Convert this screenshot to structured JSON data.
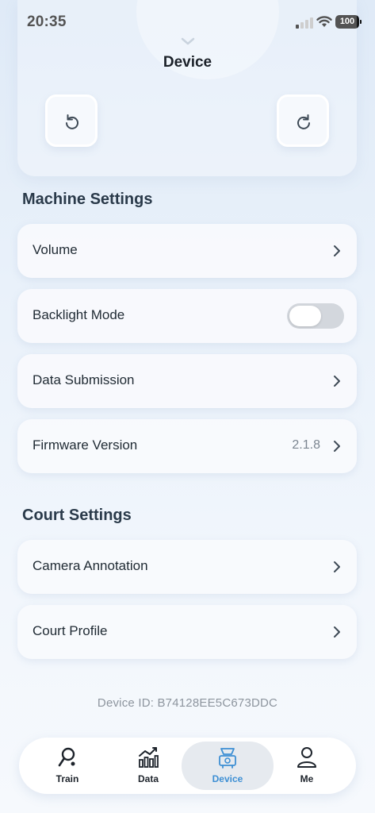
{
  "status_bar": {
    "time": "20:35",
    "battery": "100"
  },
  "header": {
    "title": "Device"
  },
  "machine_settings": {
    "title": "Machine Settings",
    "items": [
      {
        "label": "Volume"
      },
      {
        "label": "Backlight Mode",
        "toggle_on": false
      },
      {
        "label": "Data Submission"
      },
      {
        "label": "Firmware Version",
        "value": "2.1.8"
      }
    ]
  },
  "court_settings": {
    "title": "Court Settings",
    "items": [
      {
        "label": "Camera Annotation"
      },
      {
        "label": "Court Profile"
      }
    ]
  },
  "device_id": "Device ID: B74128EE5C673DDC",
  "tabs": [
    {
      "label": "Train",
      "icon": "racket-icon"
    },
    {
      "label": "Data",
      "icon": "bar-chart-icon"
    },
    {
      "label": "Device",
      "icon": "machine-icon",
      "active": true
    },
    {
      "label": "Me",
      "icon": "person-icon"
    }
  ],
  "colors": {
    "accent": "#3d8fd4",
    "active_tab_bg": "#e6eaef",
    "toggle_off": "#d3d7dd"
  }
}
